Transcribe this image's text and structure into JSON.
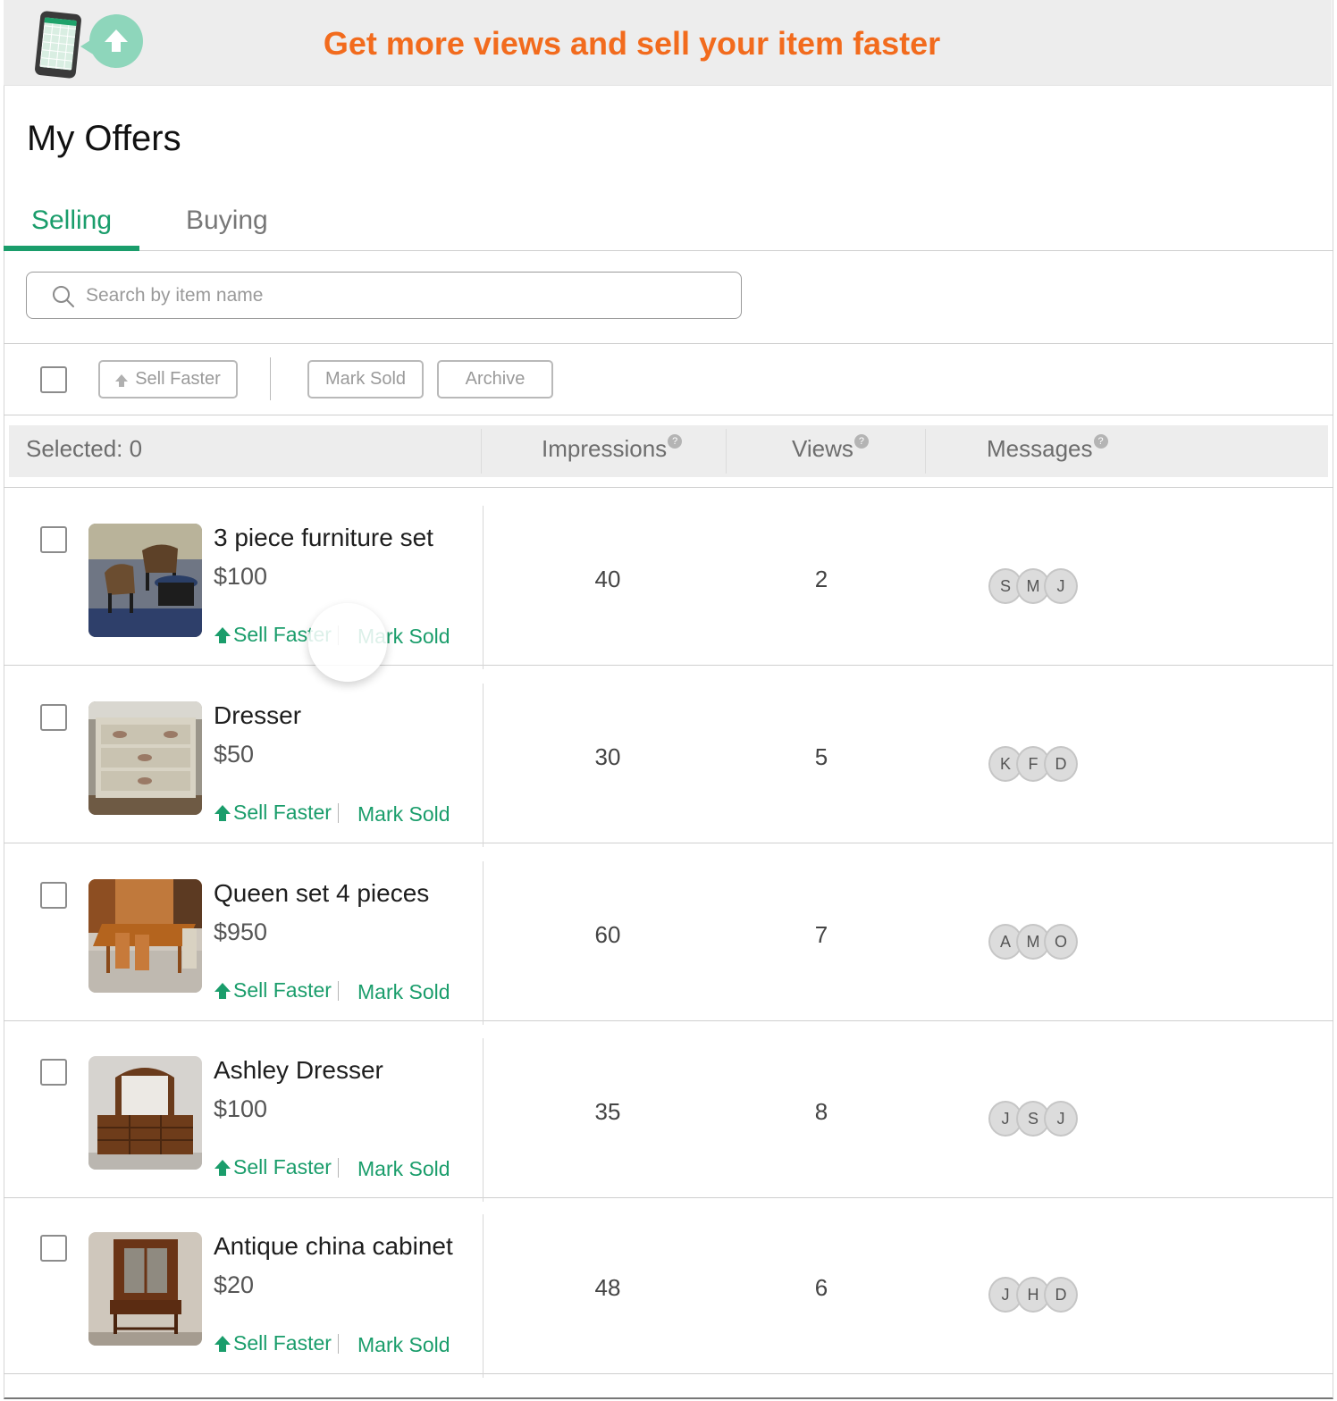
{
  "banner": {
    "text": "Get more views and sell your item faster",
    "accent": "#f26b1d",
    "icons": [
      "phone-icon",
      "upload-bubble-icon"
    ]
  },
  "page": {
    "title": "My Offers"
  },
  "tabs": [
    {
      "label": "Selling",
      "active": true
    },
    {
      "label": "Buying",
      "active": false
    }
  ],
  "search": {
    "placeholder": "Search by item name",
    "value": ""
  },
  "bulk_actions": {
    "sell_faster": "Sell Faster",
    "mark_sold": "Mark Sold",
    "archive": "Archive"
  },
  "table": {
    "selected_label": "Selected: 0",
    "headers": {
      "impressions": "Impressions",
      "views": "Views",
      "messages": "Messages"
    },
    "help_glyph": "?"
  },
  "row_actions": {
    "sell_faster": "Sell Faster",
    "mark_sold": "Mark Sold"
  },
  "items": [
    {
      "name": "3 piece furniture set",
      "price": "$100",
      "impressions": "40",
      "views": "2",
      "messages": [
        "S",
        "M",
        "J"
      ]
    },
    {
      "name": "Dresser",
      "price": "$50",
      "impressions": "30",
      "views": "5",
      "messages": [
        "K",
        "F",
        "D"
      ]
    },
    {
      "name": "Queen set 4 pieces",
      "price": "$950",
      "impressions": "60",
      "views": "7",
      "messages": [
        "A",
        "M",
        "O"
      ]
    },
    {
      "name": "Ashley Dresser",
      "price": "$100",
      "impressions": "35",
      "views": "8",
      "messages": [
        "J",
        "S",
        "J"
      ]
    },
    {
      "name": "Antique china cabinet",
      "price": "$20",
      "impressions": "48",
      "views": "6",
      "messages": [
        "J",
        "H",
        "D"
      ]
    }
  ],
  "colors": {
    "brand_green": "#1a9d6b",
    "banner_bg": "#ededed"
  }
}
